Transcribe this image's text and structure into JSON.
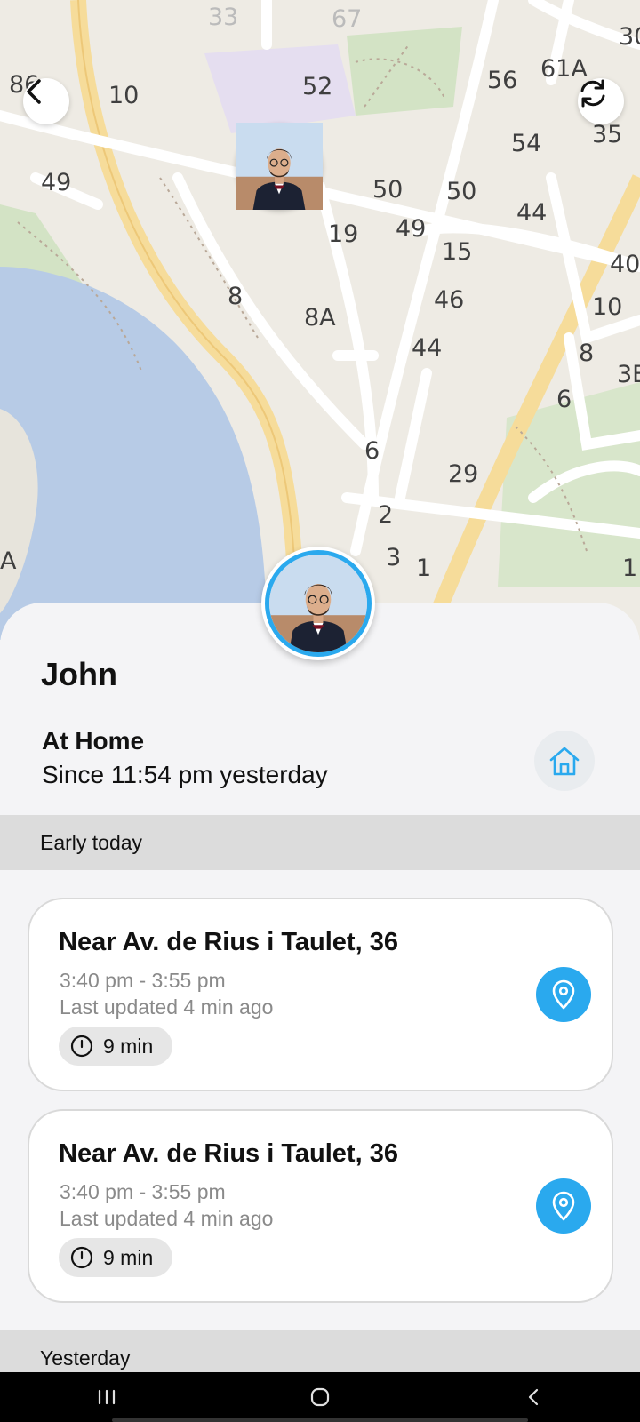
{
  "map": {
    "labels": [
      "33",
      "67",
      "30",
      "86",
      "10",
      "52",
      "56",
      "61A",
      "35",
      "54",
      "49",
      "50",
      "50",
      "44",
      "19",
      "49",
      "15",
      "40",
      "8",
      "46",
      "10",
      "8A",
      "44",
      "8",
      "3E",
      "6",
      "6",
      "29",
      "2",
      "3",
      "1",
      "1",
      "A"
    ],
    "icons": {
      "back": "chevron-left-icon",
      "refresh": "refresh-icon"
    }
  },
  "profile": {
    "name": "John",
    "status_title": "At Home",
    "status_since": "Since 11:54 pm yesterday",
    "status_icon": "home-icon",
    "accent_color": "#2aa9ee"
  },
  "sections": {
    "today_label": "Early today",
    "yesterday_label": "Yesterday"
  },
  "visits": [
    {
      "place": "Near Av. de Rius i Taulet, 36",
      "time_range": "3:40 pm - 3:55 pm",
      "updated": "Last updated 4 min ago",
      "duration": "9 min"
    },
    {
      "place": "Near Av. de Rius i Taulet, 36",
      "time_range": "3:40 pm - 3:55 pm",
      "updated": "Last updated 4 min ago",
      "duration": "9 min"
    }
  ],
  "navbar": {
    "icons": [
      "recent-apps-icon",
      "home-circle-icon",
      "back-icon"
    ]
  }
}
